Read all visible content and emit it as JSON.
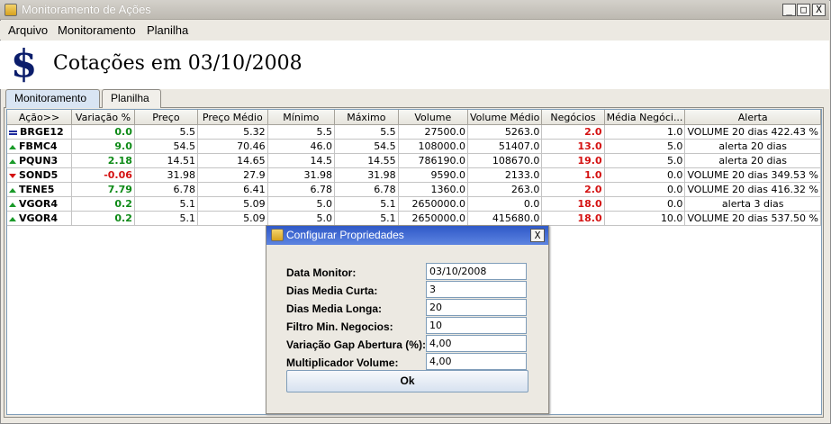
{
  "window": {
    "title": "Monitoramento de Ações",
    "btn_min": "_",
    "btn_max": "□",
    "btn_close": "X"
  },
  "menu": [
    {
      "label": "Arquivo"
    },
    {
      "label": "Monitoramento"
    },
    {
      "label": "Planilha"
    }
  ],
  "header": {
    "icon": "$",
    "title": "Cotações em 03/10/2008"
  },
  "tabs": [
    {
      "label": "Monitoramento"
    },
    {
      "label": "Planilha"
    }
  ],
  "table": {
    "columns": [
      "Ação>>",
      "Variação %",
      "Preço",
      "Preço Médio",
      "Mínimo",
      "Máximo",
      "Volume",
      "Volume Médio",
      "Negócios",
      "Média Negóci...",
      "Alerta"
    ],
    "rows": [
      {
        "trend": "flat",
        "cells": [
          "BRGE12",
          "0.0",
          "5.5",
          "5.32",
          "5.5",
          "5.5",
          "27500.0",
          "5263.0",
          "2.0",
          "1.0",
          "VOLUME 20 dias 422.43 %"
        ]
      },
      {
        "trend": "up",
        "cells": [
          "FBMC4",
          "9.0",
          "54.5",
          "70.46",
          "46.0",
          "54.5",
          "108000.0",
          "51407.0",
          "13.0",
          "5.0",
          "alerta 20 dias"
        ]
      },
      {
        "trend": "up",
        "cells": [
          "PQUN3",
          "2.18",
          "14.51",
          "14.65",
          "14.5",
          "14.55",
          "786190.0",
          "108670.0",
          "19.0",
          "5.0",
          "alerta 20 dias"
        ]
      },
      {
        "trend": "down",
        "cells": [
          "SOND5",
          "-0.06",
          "31.98",
          "27.9",
          "31.98",
          "31.98",
          "9590.0",
          "2133.0",
          "1.0",
          "0.0",
          "VOLUME 20 dias 349.53 %"
        ]
      },
      {
        "trend": "up",
        "cells": [
          "TENE5",
          "7.79",
          "6.78",
          "6.41",
          "6.78",
          "6.78",
          "1360.0",
          "263.0",
          "2.0",
          "0.0",
          "VOLUME 20 dias 416.32 %"
        ]
      },
      {
        "trend": "up",
        "cells": [
          "VGOR4",
          "0.2",
          "5.1",
          "5.09",
          "5.0",
          "5.1",
          "2650000.0",
          "0.0",
          "18.0",
          "0.0",
          "alerta 3 dias"
        ]
      },
      {
        "trend": "up",
        "cells": [
          "VGOR4",
          "0.2",
          "5.1",
          "5.09",
          "5.0",
          "5.1",
          "2650000.0",
          "415680.0",
          "18.0",
          "10.0",
          "VOLUME 20 dias 537.50 %"
        ]
      }
    ]
  },
  "dialog": {
    "title": "Configurar Propriedades",
    "close": "X",
    "fields": [
      {
        "label": "Data Monitor:",
        "value": "03/10/2008"
      },
      {
        "label": "Dias Media Curta:",
        "value": "3"
      },
      {
        "label": "Dias Media Longa:",
        "value": "20"
      },
      {
        "label": "Filtro Min. Negocios:",
        "value": "10"
      },
      {
        "label": "Variação Gap Abertura (%):",
        "value": "4,00"
      },
      {
        "label": "Multiplicador Volume:",
        "value": "4,00"
      }
    ],
    "ok_label": "Ok"
  },
  "colors": {
    "positive": "#0e8a17",
    "negative": "#d41111",
    "dialog_title": "#2f59c8"
  }
}
